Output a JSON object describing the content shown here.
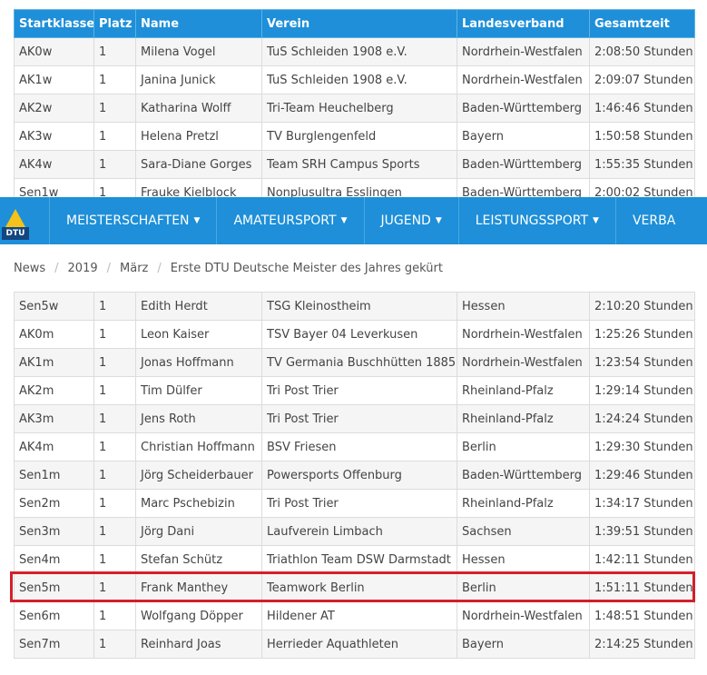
{
  "table": {
    "headers": [
      "Startklasse",
      "Platz",
      "Name",
      "Verein",
      "Landesverband",
      "Gesamtzeit"
    ],
    "rows_top": [
      [
        "AK0w",
        "1",
        "Milena Vogel",
        "TuS Schleiden 1908 e.V.",
        "Nordrhein-Westfalen",
        "2:08:50 Stunden"
      ],
      [
        "AK1w",
        "1",
        "Janina Junick",
        "TuS Schleiden 1908 e.V.",
        "Nordrhein-Westfalen",
        "2:09:07 Stunden"
      ],
      [
        "AK2w",
        "1",
        "Katharina Wolff",
        "Tri-Team Heuchelberg",
        "Baden-Württemberg",
        "1:46:46 Stunden"
      ],
      [
        "AK3w",
        "1",
        "Helena Pretzl",
        "TV Burglengenfeld",
        "Bayern",
        "1:50:58 Stunden"
      ],
      [
        "AK4w",
        "1",
        "Sara-Diane Gorges",
        "Team SRH Campus Sports",
        "Baden-Württemberg",
        "1:55:35 Stunden"
      ],
      [
        "Sen1w",
        "1",
        "Frauke Kielblock",
        "Nonplusultra Esslingen",
        "Baden-Württemberg",
        "2:00:02 Stunden"
      ]
    ],
    "rows_bottom": [
      [
        "Sen5w",
        "1",
        "Edith Herdt",
        "TSG Kleinostheim",
        "Hessen",
        "2:10:20 Stunden"
      ],
      [
        "AK0m",
        "1",
        "Leon Kaiser",
        "TSV Bayer 04 Leverkusen",
        "Nordrhein-Westfalen",
        "1:25:26 Stunden"
      ],
      [
        "AK1m",
        "1",
        " Jonas Hoffmann",
        "TV Germania Buschhütten 1885",
        "Nordrhein-Westfalen",
        "1:23:54 Stunden"
      ],
      [
        "AK2m",
        "1",
        "Tim Dülfer",
        "Tri Post Trier",
        "Rheinland-Pfalz",
        "1:29:14 Stunden"
      ],
      [
        "AK3m",
        "1",
        "Jens Roth",
        "Tri Post Trier",
        "Rheinland-Pfalz",
        "1:24:24 Stunden"
      ],
      [
        "AK4m",
        "1",
        "Christian  Hoffmann",
        "BSV Friesen",
        "Berlin",
        "1:29:30 Stunden"
      ],
      [
        "Sen1m",
        "1",
        "Jörg Scheiderbauer",
        "Powersports Offenburg",
        "Baden-Württemberg",
        "1:29:46 Stunden"
      ],
      [
        "Sen2m",
        "1",
        "Marc Pschebizin",
        "Tri Post Trier",
        "Rheinland-Pfalz",
        "1:34:17 Stunden"
      ],
      [
        "Sen3m",
        "1",
        "Jörg Dani",
        "Laufverein Limbach",
        "Sachsen",
        "1:39:51 Stunden"
      ],
      [
        "Sen4m",
        "1",
        "Stefan Schütz",
        "Triathlon Team DSW Darmstadt",
        "Hessen",
        "1:42:11 Stunden"
      ],
      [
        "Sen5m",
        "1",
        "Frank Manthey",
        "Teamwork Berlin",
        "Berlin",
        "1:51:11 Stunden"
      ],
      [
        "Sen6m",
        "1",
        " Wolfgang Döpper",
        "Hildener AT",
        "Nordrhein-Westfalen",
        "1:48:51 Stunden"
      ],
      [
        "Sen7m",
        "1",
        "Reinhard Joas",
        "Herrieder Aquathleten",
        "Bayern",
        "2:14:25 Stunden"
      ]
    ]
  },
  "nav": {
    "logo_text": "DTU",
    "items": [
      "MEISTERSCHAFTEN",
      "AMATEURSPORT",
      "JUGEND",
      "LEISTUNGSSPORT",
      "VERBA"
    ]
  },
  "breadcrumb": [
    "News",
    "2019",
    "März",
    "Erste DTU Deutsche Meister des Jahres gekürt"
  ],
  "colors": {
    "nav": "#1e8fd8",
    "highlight": "#d3202a",
    "logo_yellow": "#f4c21a"
  },
  "highlighted_row": "Sen5m"
}
